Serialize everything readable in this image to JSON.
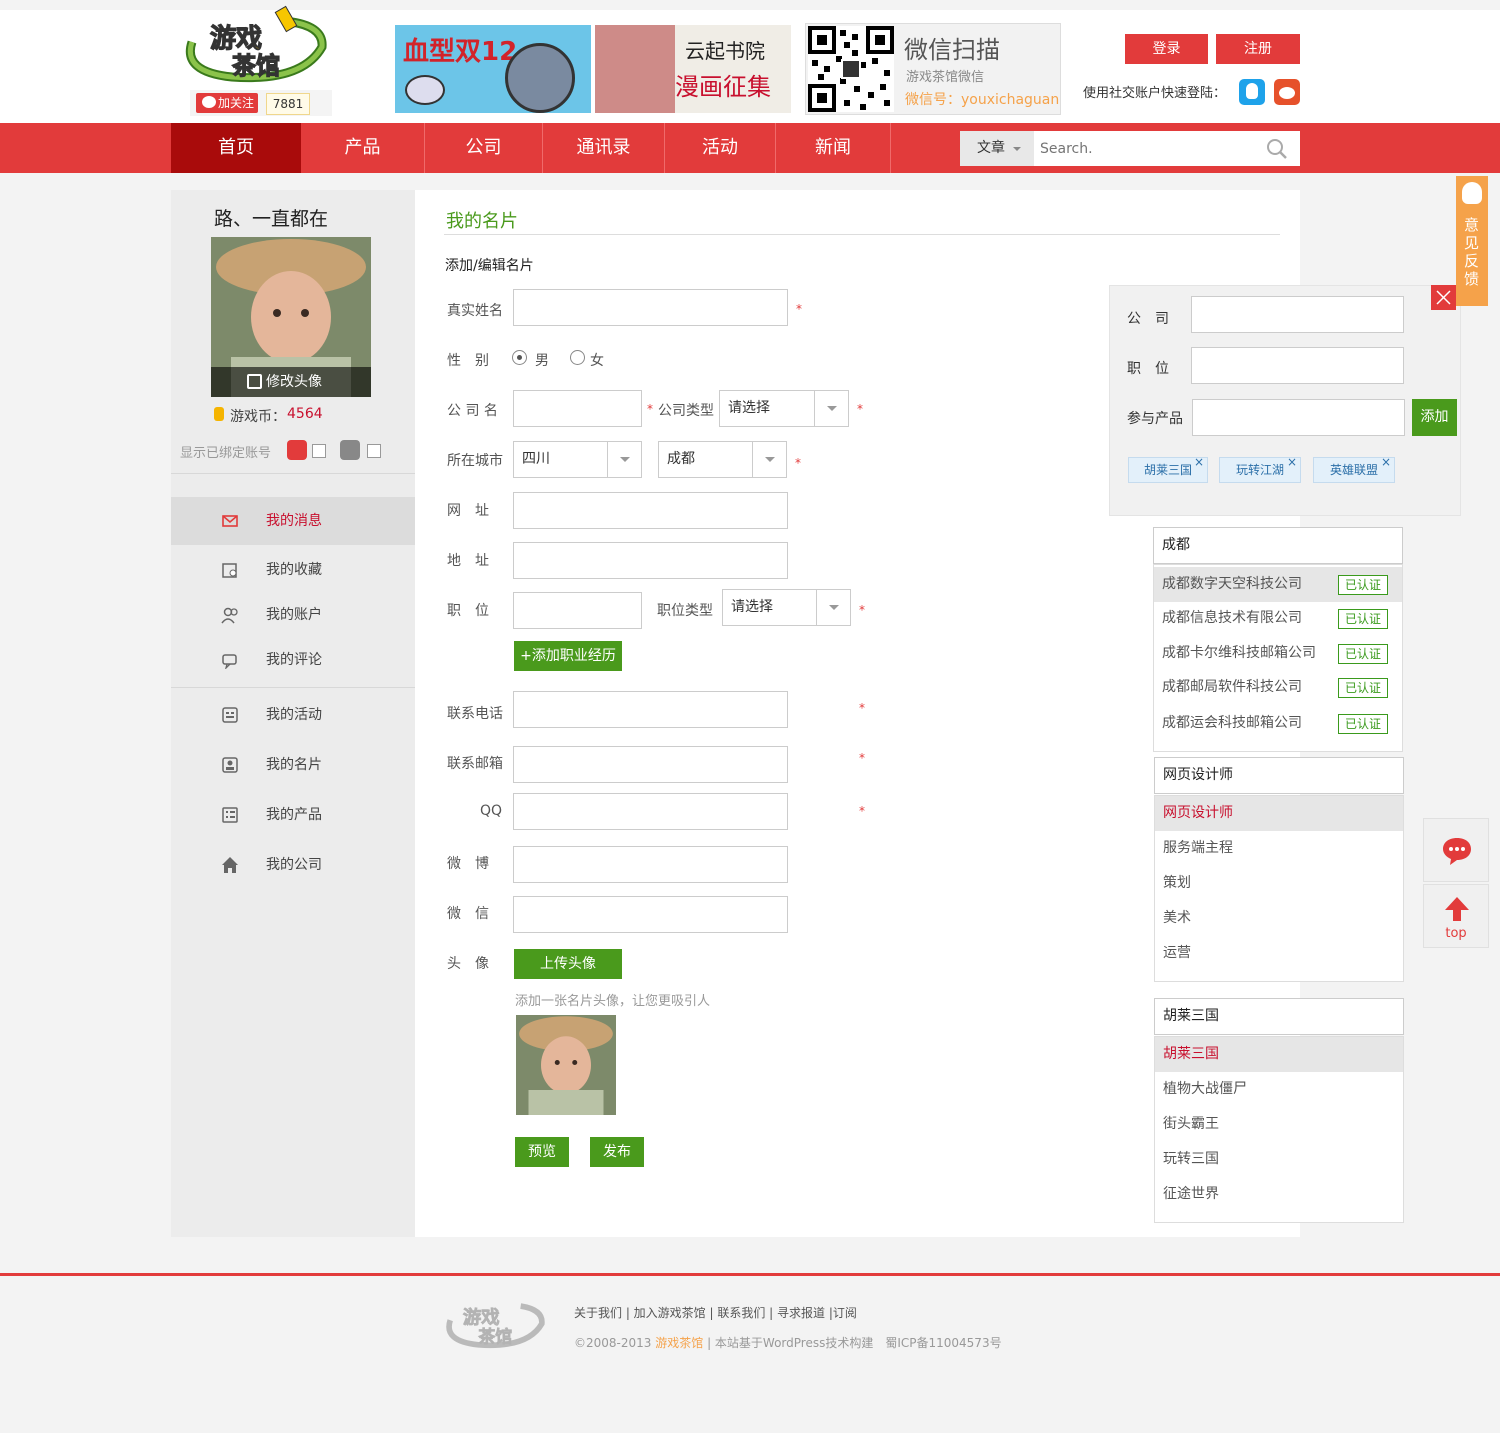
{
  "colors": {
    "brand_red": "#e23b3b",
    "nav_active": "#a90b0b",
    "accent_green": "#4a9a1c",
    "feedback_orange": "#f5a24a"
  },
  "header": {
    "follow_label": "加关注",
    "follow_count": "7881",
    "banner1_text": "血型双12",
    "banner2_title": "云起书院",
    "banner2_sub": "漫画征集",
    "wechat_title": "微信扫描",
    "wechat_sub": "游戏茶馆微信",
    "wechat_id": "微信号：youxichaguan",
    "login": "登录",
    "register": "注册",
    "social_login": "使用社交账户快速登陆："
  },
  "nav": {
    "items": [
      "首页",
      "产品",
      "公司",
      "通讯录",
      "活动",
      "新闻"
    ],
    "search_category": "文章",
    "search_placeholder": "Search."
  },
  "sidebar": {
    "username": "路、一直都在",
    "edit_avatar": "修改头像",
    "coin_label": "游戏币：",
    "coin_value": "4564",
    "bound_label": "显示已绑定账号",
    "menu": [
      "我的消息",
      "我的收藏",
      "我的账户",
      "我的评论",
      "我的活动",
      "我的名片",
      "我的产品",
      "我的公司"
    ]
  },
  "main": {
    "title": "我的名片",
    "subtitle": "添加/编辑名片",
    "real_name": "真实姓名",
    "gender": "性　别",
    "male": "男",
    "female": "女",
    "company_name": "公 司 名",
    "company_type": "公司类型",
    "please_select": "请选择",
    "city": "所在城市",
    "province": "四川",
    "city_value": "成都",
    "website": "网　址",
    "address": "地　址",
    "position": "职　位",
    "position_type": "职位类型",
    "add_exp": "+添加职业经历",
    "phone": "联系电话",
    "email": "联系邮箱",
    "qq": "QQ",
    "weibo": "微　博",
    "wechat": "微　信",
    "avatar": "头　像",
    "upload": "上传头像",
    "avatar_hint": "添加一张名片头像，让您更吸引人",
    "preview": "预览",
    "publish": "发布",
    "required": "*"
  },
  "panel": {
    "company": "公　司",
    "position": "职　位",
    "product": "参与产品",
    "add": "添加",
    "tags": [
      "胡莱三国",
      "玩转江湖",
      "英雄联盟"
    ],
    "tag_close": "×"
  },
  "dropdown_company": {
    "input": "成都",
    "items": [
      "成都数字天空科技公司",
      "成都信息技术有限公司",
      "成都卡尔维科技邮箱公司",
      "成都邮局软件科技公司",
      "成都运会科技邮箱公司"
    ],
    "badge": "已认证"
  },
  "dropdown_position": {
    "input": "网页设计师",
    "items": [
      "网页设计师",
      "服务端主程",
      "策划",
      "美术",
      "运营"
    ]
  },
  "dropdown_product": {
    "input": "胡莱三国",
    "items": [
      "胡莱三国",
      "植物大战僵尸",
      "街头霸王",
      "玩转三国",
      "征途世界"
    ]
  },
  "float": {
    "feedback": "意见反馈",
    "top": "top"
  },
  "footer": {
    "links": "关于我们 | 加入游戏茶馆 | 联系我们 | 寻求报道 |订阅",
    "copy_pre": "©2008-2013 ",
    "copy_brand": "游戏茶馆",
    "copy_post": " | 本站基于WordPress技术构建　蜀ICP备11004573号"
  }
}
